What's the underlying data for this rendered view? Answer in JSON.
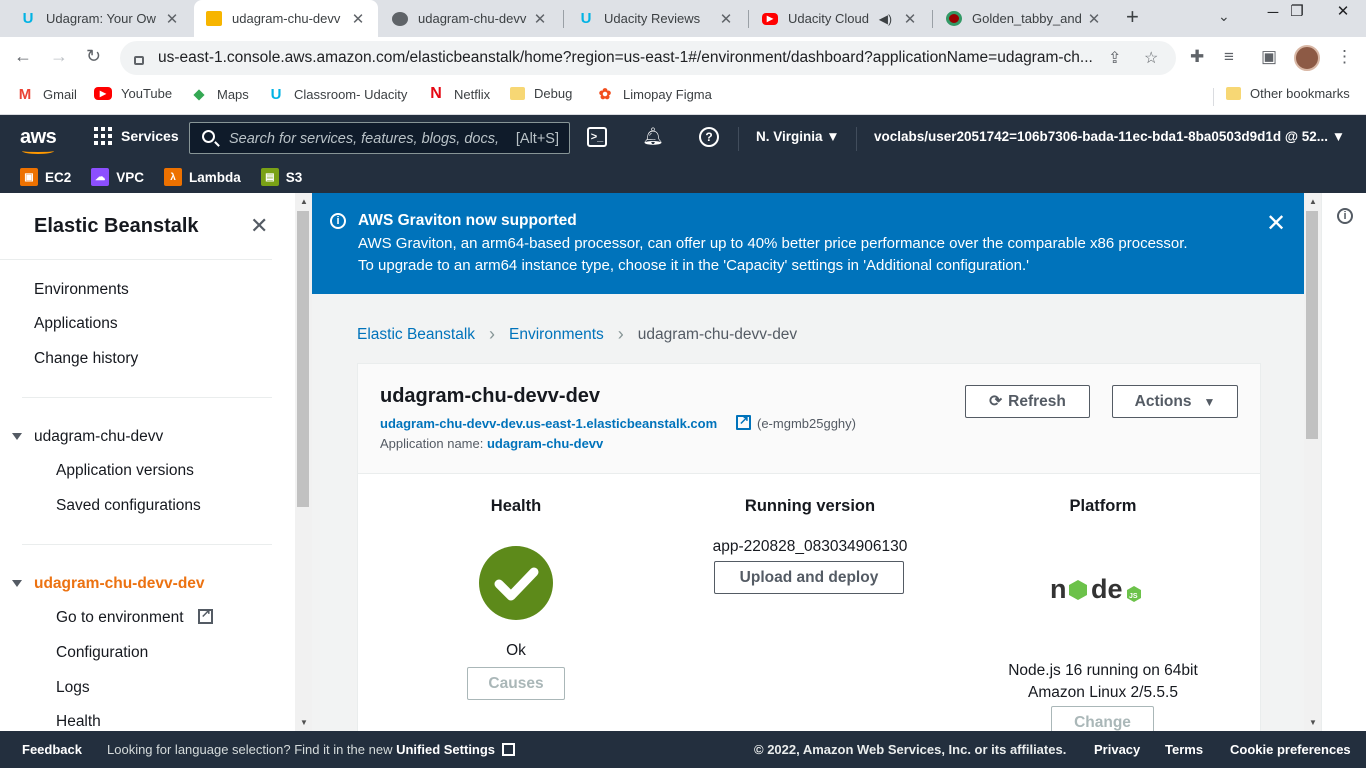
{
  "browser": {
    "tabs": [
      {
        "title": "Udagram: Your Ow",
        "icon": "udacity-icon"
      },
      {
        "title": "udagram-chu-devv",
        "icon": "aws-box-icon",
        "active": true
      },
      {
        "title": "udagram-chu-devv",
        "icon": "globe-icon"
      },
      {
        "title": "Udacity Reviews",
        "icon": "udacity-icon"
      },
      {
        "title": "Udacity Cloud",
        "icon": "youtube-icon"
      },
      {
        "title": "Golden_tabby_and",
        "icon": "wikimedia-icon"
      }
    ],
    "url": "us-east-1.console.aws.amazon.com/elasticbeanstalk/home?region=us-east-1#/environment/dashboard?applicationName=udagram-ch...",
    "bookmarks": [
      "Gmail",
      "YouTube",
      "Maps",
      "Classroom- Udacity",
      "Netflix",
      "Debug",
      "Limopay Figma"
    ],
    "other_bookmarks": "Other bookmarks"
  },
  "aws": {
    "logo": "aws",
    "services": "Services",
    "search_placeholder": "Search for services, features, blogs, docs, and more",
    "search_shortcut": "[Alt+S]",
    "region": "N. Virginia ▼",
    "account": "voclabs/user2051742=106b7306-bada-11ec-bda1-8ba0503d9d1d @ 52... ▼",
    "favorites": [
      "EC2",
      "VPC",
      "Lambda",
      "S3"
    ],
    "favorite_colors": [
      "#ed7100",
      "#8c4fff",
      "#ed7100",
      "#7aa116"
    ]
  },
  "sidebar": {
    "title": "Elastic Beanstalk",
    "top_items": [
      "Environments",
      "Applications",
      "Change history"
    ],
    "app_group": "udagram-chu-devv",
    "app_items": [
      "Application versions",
      "Saved configurations"
    ],
    "env_group": "udagram-chu-devv-dev",
    "env_items": [
      "Go to environment",
      "Configuration",
      "Logs",
      "Health"
    ]
  },
  "banner": {
    "title": "AWS Graviton now supported",
    "line1": "AWS Graviton, an arm64-based processor, can offer up to 40% better price performance over the comparable x86 processor.",
    "line2": "To upgrade to an arm64 instance type, choose it in the 'Capacity' settings in 'Additional configuration.'"
  },
  "breadcrumb": [
    "Elastic Beanstalk",
    "Environments",
    "udagram-chu-devv-dev"
  ],
  "environment": {
    "name": "udagram-chu-devv-dev",
    "url": "udagram-chu-devv-dev.us-east-1.elasticbeanstalk.com",
    "id": "(e-mgmb25gghy)",
    "app_name_label": "Application name:",
    "app_name": "udagram-chu-devv",
    "refresh": "Refresh",
    "actions": "Actions"
  },
  "health": {
    "heading": "Health",
    "status": "Ok",
    "causes": "Causes",
    "color": "#5d8a1a"
  },
  "running": {
    "heading": "Running version",
    "version": "app-220828_083034906130",
    "upload": "Upload and deploy"
  },
  "platform": {
    "heading": "Platform",
    "line1": "Node.js 16 running on 64bit",
    "line2": "Amazon Linux 2/5.5.5",
    "change": "Change"
  },
  "footer": {
    "feedback": "Feedback",
    "lang_prompt": "Looking for language selection? Find it in the new",
    "unified": "Unified Settings",
    "copyright": "© 2022, Amazon Web Services, Inc. or its affiliates.",
    "privacy": "Privacy",
    "terms": "Terms",
    "cookies": "Cookie preferences"
  }
}
